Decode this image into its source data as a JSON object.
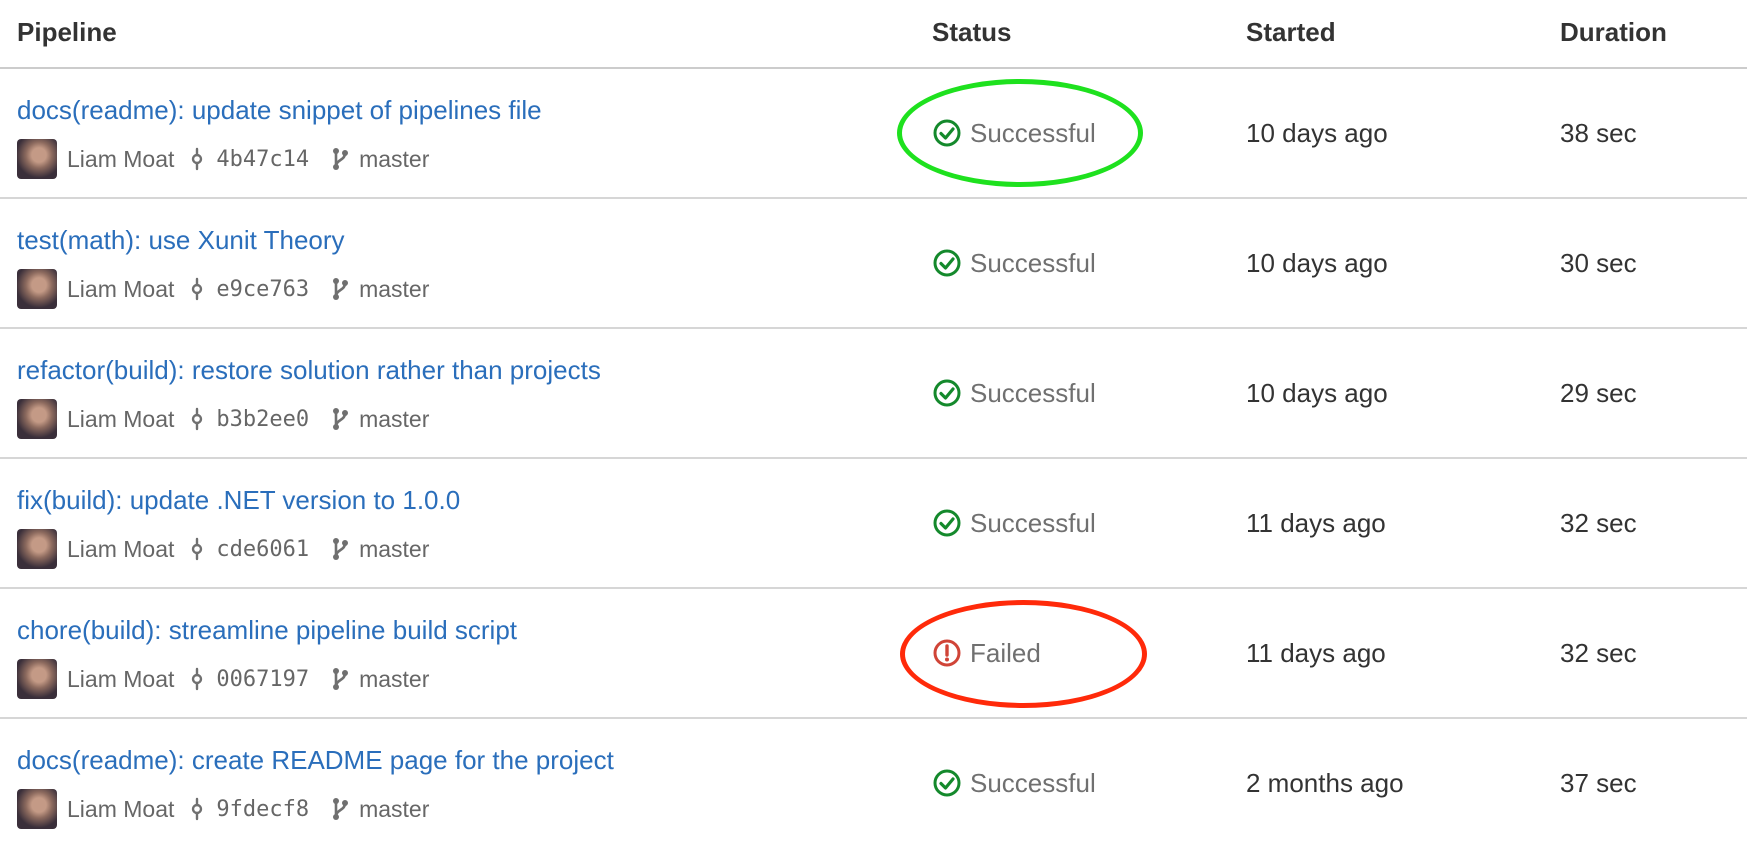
{
  "header": {
    "pipeline": "Pipeline",
    "status": "Status",
    "started": "Started",
    "duration": "Duration"
  },
  "colors": {
    "link": "#2a6ebb",
    "success": "#14892c",
    "failed": "#d04437",
    "annotation_green": "#1ee11e",
    "annotation_red": "#ff2a0a"
  },
  "icons": {
    "commit": "commit-icon",
    "branch": "branch-icon",
    "success": "check-circle-icon",
    "failed": "exclamation-circle-icon"
  },
  "rows": [
    {
      "title": "docs(readme): update snippet of pipelines file",
      "author": "Liam Moat",
      "commit": "4b47c14",
      "branch": "master",
      "status": "Successful",
      "state": "success",
      "started": "10 days ago",
      "duration": "38 sec",
      "annotation": "green"
    },
    {
      "title": "test(math): use Xunit Theory",
      "author": "Liam Moat",
      "commit": "e9ce763",
      "branch": "master",
      "status": "Successful",
      "state": "success",
      "started": "10 days ago",
      "duration": "30 sec"
    },
    {
      "title": "refactor(build): restore solution rather than projects",
      "author": "Liam Moat",
      "commit": "b3b2ee0",
      "branch": "master",
      "status": "Successful",
      "state": "success",
      "started": "10 days ago",
      "duration": "29 sec"
    },
    {
      "title": "fix(build): update .NET version to 1.0.0",
      "author": "Liam Moat",
      "commit": "cde6061",
      "branch": "master",
      "status": "Successful",
      "state": "success",
      "started": "11 days ago",
      "duration": "32 sec"
    },
    {
      "title": "chore(build): streamline pipeline build script",
      "author": "Liam Moat",
      "commit": "0067197",
      "branch": "master",
      "status": "Failed",
      "state": "failed",
      "started": "11 days ago",
      "duration": "32 sec",
      "annotation": "red"
    },
    {
      "title": "docs(readme): create README page for the project",
      "author": "Liam Moat",
      "commit": "9fdecf8",
      "branch": "master",
      "status": "Successful",
      "state": "success",
      "started": "2 months ago",
      "duration": "37 sec"
    }
  ]
}
